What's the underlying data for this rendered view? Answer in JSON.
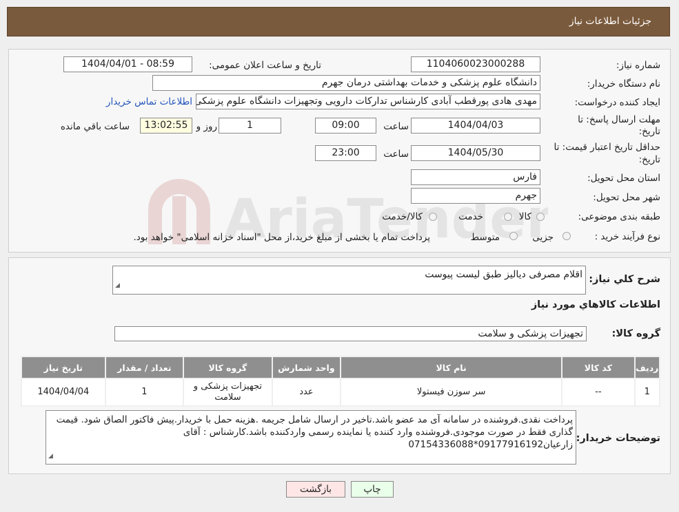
{
  "header": {
    "title": "جزئیات اطلاعات نیاز"
  },
  "details": {
    "need_number_label": "شماره نیاز:",
    "need_number": "1104060023000288",
    "announce_label": "تاریخ و ساعت اعلان عمومی:",
    "announce_value": "1404/04/01 - 08:59",
    "buyer_org_label": "نام دستگاه خریدار:",
    "buyer_org": "دانشگاه علوم پزشکی و خدمات بهداشتی  درمان جهرم",
    "creator_label": "ایجاد کننده درخواست:",
    "creator": "مهدی هادی پورقطب آبادی کارشناس تدارکات دارویی وتجهیزات دانشگاه علوم پزشکی",
    "contact_link": "اطلاعات تماس خریدار",
    "deadline_label_1": "مهلت ارسال پاسخ: تا",
    "deadline_label_2": "تاریخ:",
    "deadline_date": "1404/04/03",
    "time_label": "ساعت",
    "deadline_time": "09:00",
    "days_value": "1",
    "days_label": "روز و",
    "remaining_time": "13:02:55",
    "remaining_label": "ساعت باقي مانده",
    "validity_label_1": "حداقل تاریخ اعتبار قیمت: تا",
    "validity_label_2": "تاریخ:",
    "validity_date": "1404/05/30",
    "validity_time_label": "ساعت",
    "validity_time": "23:00",
    "province_label": "استان محل تحویل:",
    "province": "فارس",
    "city_label": "شهر محل تحویل:",
    "city": "جهرم",
    "category_label": "طبقه بندی موضوعی:",
    "category_options": [
      "کالا",
      "خدمت",
      "کالا/خدمت"
    ],
    "process_label": "نوع فرآیند خرید :",
    "process_options": [
      "جزیی",
      "متوسط"
    ],
    "process_note": "پرداخت تمام یا بخشی از مبلغ خرید،از محل \"اسناد خزانه اسلامی\" خواهد بود."
  },
  "watermark": {
    "text": "AriaTender.neT"
  },
  "summary": {
    "desc_label": "شرح کلي نياز:",
    "desc_value": "اقلام مصرفی دیالیز طبق لیست پیوست",
    "items_heading": "اطلاعات کالاهاي مورد نياز",
    "group_label": "گروه کالا:",
    "group_value": "تجهیزات پزشکی و سلامت"
  },
  "table": {
    "headers": [
      "ردیف",
      "کد کالا",
      "نام کالا",
      "واحد شمارش",
      "گروه کالا",
      "تعداد / مقدار",
      "تاریخ نیاز"
    ],
    "rows": [
      [
        "1",
        "--",
        "سر سوزن فیستولا",
        "عدد",
        "تجهیزات پزشکی و سلامت",
        "1",
        "1404/04/04"
      ]
    ]
  },
  "notes": {
    "label": "توضیحات خریدار:",
    "text": "پرداخت نقدی.فروشنده در سامانه آی مد عضو باشد.تاخیر در ارسال شامل جریمه .هزینه حمل با خریدار.پیش فاکتور الصاق شود. قیمت گذاری فقط در صورت موجودی.فروشنده وارد کننده یا نماینده رسمی واردکننده باشد.کارشناس : آقای زارعیان09177916192*07154336088"
  },
  "buttons": {
    "print": "چاپ",
    "back": "بازگشت"
  }
}
